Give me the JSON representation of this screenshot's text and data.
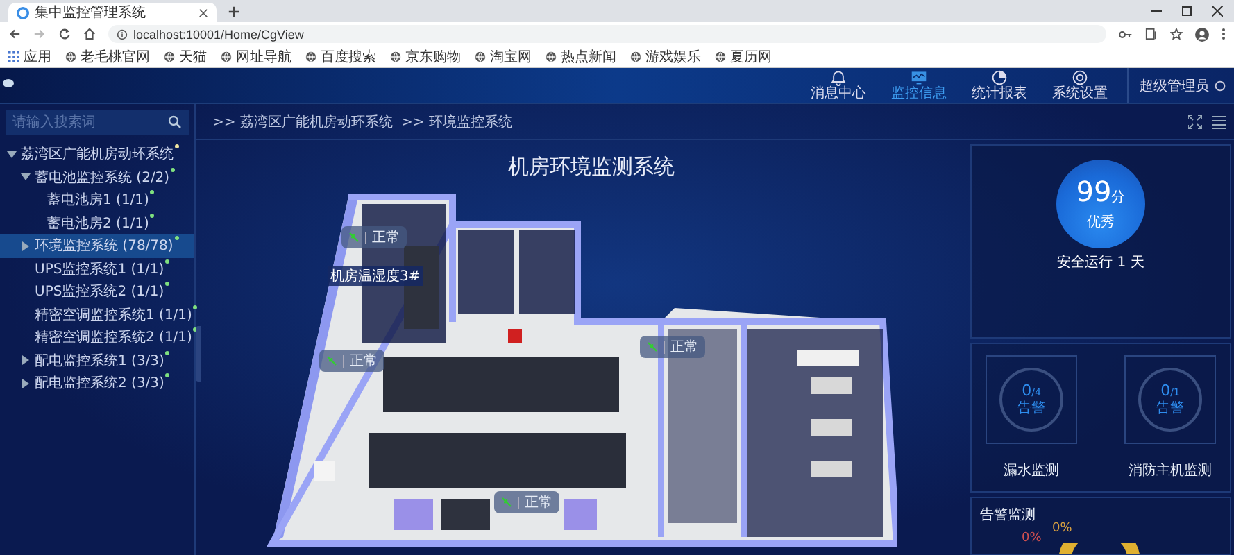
{
  "browser": {
    "tab_title": "集中监控管理系统",
    "url": "localhost:10001/Home/CgView",
    "bookmarks": [
      "应用",
      "老毛桃官网",
      "天猫",
      "网址导航",
      "百度搜索",
      "京东购物",
      "淘宝网",
      "热点新闻",
      "游戏娱乐",
      "夏历网"
    ]
  },
  "header": {
    "nav": [
      {
        "label": "消息中心",
        "selected": false
      },
      {
        "label": "监控信息",
        "selected": true
      },
      {
        "label": "统计报表",
        "selected": false
      },
      {
        "label": "系统设置",
        "selected": false
      }
    ],
    "user": "超级管理员"
  },
  "sidebar": {
    "search": {
      "placeholder": "请输入搜索词"
    },
    "tree": [
      {
        "label": "荔湾区广能机房动环系统",
        "color": "#f0e6a0",
        "expanded": true,
        "selected": false,
        "children": [
          {
            "label": "蓄电池监控系统 (2/2)",
            "color": "#7fe07f",
            "expanded": true,
            "selected": false,
            "children": [
              {
                "label": "蓄电池房1 (1/1)",
                "color": "#7fe07f",
                "selected": false
              },
              {
                "label": "蓄电池房2 (1/1)",
                "color": "#7fe07f",
                "selected": false
              }
            ]
          },
          {
            "label": "环境监控系统 (78/78)",
            "color": "#7fe07f",
            "expanded": false,
            "selected": true
          },
          {
            "label": "UPS监控系统1 (1/1)",
            "color": "#7fe07f",
            "selected": false
          },
          {
            "label": "UPS监控系统2 (1/1)",
            "color": "#7fe07f",
            "selected": false
          },
          {
            "label": "精密空调监控系统1 (1/1)",
            "color": "#7fe07f",
            "selected": false
          },
          {
            "label": "精密空调监控系统2 (1/1)",
            "color": "#7fe07f",
            "selected": false
          },
          {
            "label": "配电监控系统1 (3/3)",
            "color": "#7fe07f",
            "expanded": false,
            "selected": false
          },
          {
            "label": "配电监控系统2 (3/3)",
            "color": "#7fe07f",
            "expanded": false,
            "selected": false
          }
        ]
      }
    ]
  },
  "breadcrumb": [
    ">> 荔湾区广能机房动环系统",
    ">> 环境监控系统"
  ],
  "main": {
    "title": "机房环境监测系统",
    "status_tags": [
      "正常",
      "正常",
      "正常",
      "正常"
    ],
    "sensor_title": "机房温湿度3#"
  },
  "score": {
    "value": "99",
    "unit": "分",
    "grade": "优秀",
    "uptime": "安全运行 1 天"
  },
  "monitors": [
    {
      "count": "0",
      "total": "/4",
      "status": "告警",
      "name": "漏水监测"
    },
    {
      "count": "0",
      "total": "/1",
      "status": "告警",
      "name": "消防主机监测"
    }
  ],
  "alarm": {
    "title": "告警监测",
    "labels": [
      {
        "text": "0%",
        "color": "#d9a040"
      },
      {
        "text": "0%",
        "color": "#d05050"
      }
    ]
  }
}
